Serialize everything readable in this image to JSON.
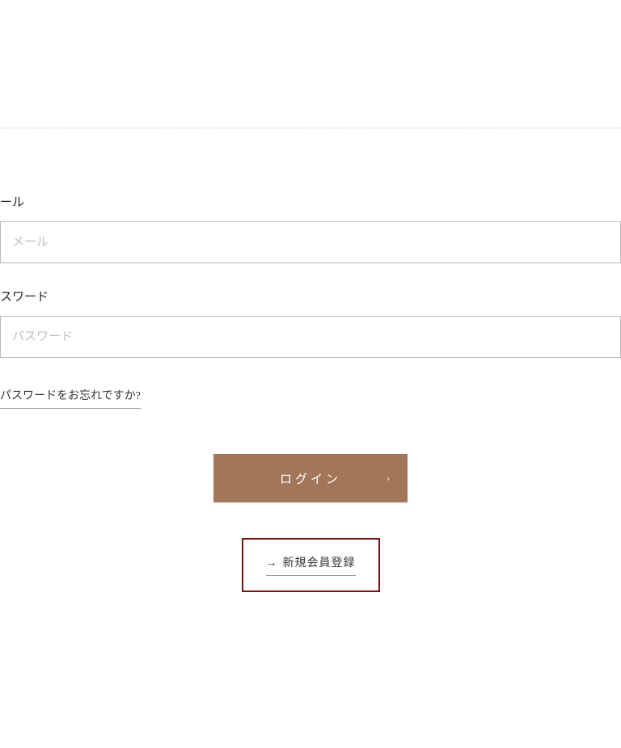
{
  "form": {
    "email_label": "ール",
    "email_placeholder": "メール",
    "password_label": "スワード",
    "password_placeholder": "パスワード",
    "forgot": "パスワードをお忘れですか?",
    "login": "ログイン",
    "chevron": "›"
  },
  "register": {
    "arrow": "→",
    "label": "新規会員登録"
  }
}
